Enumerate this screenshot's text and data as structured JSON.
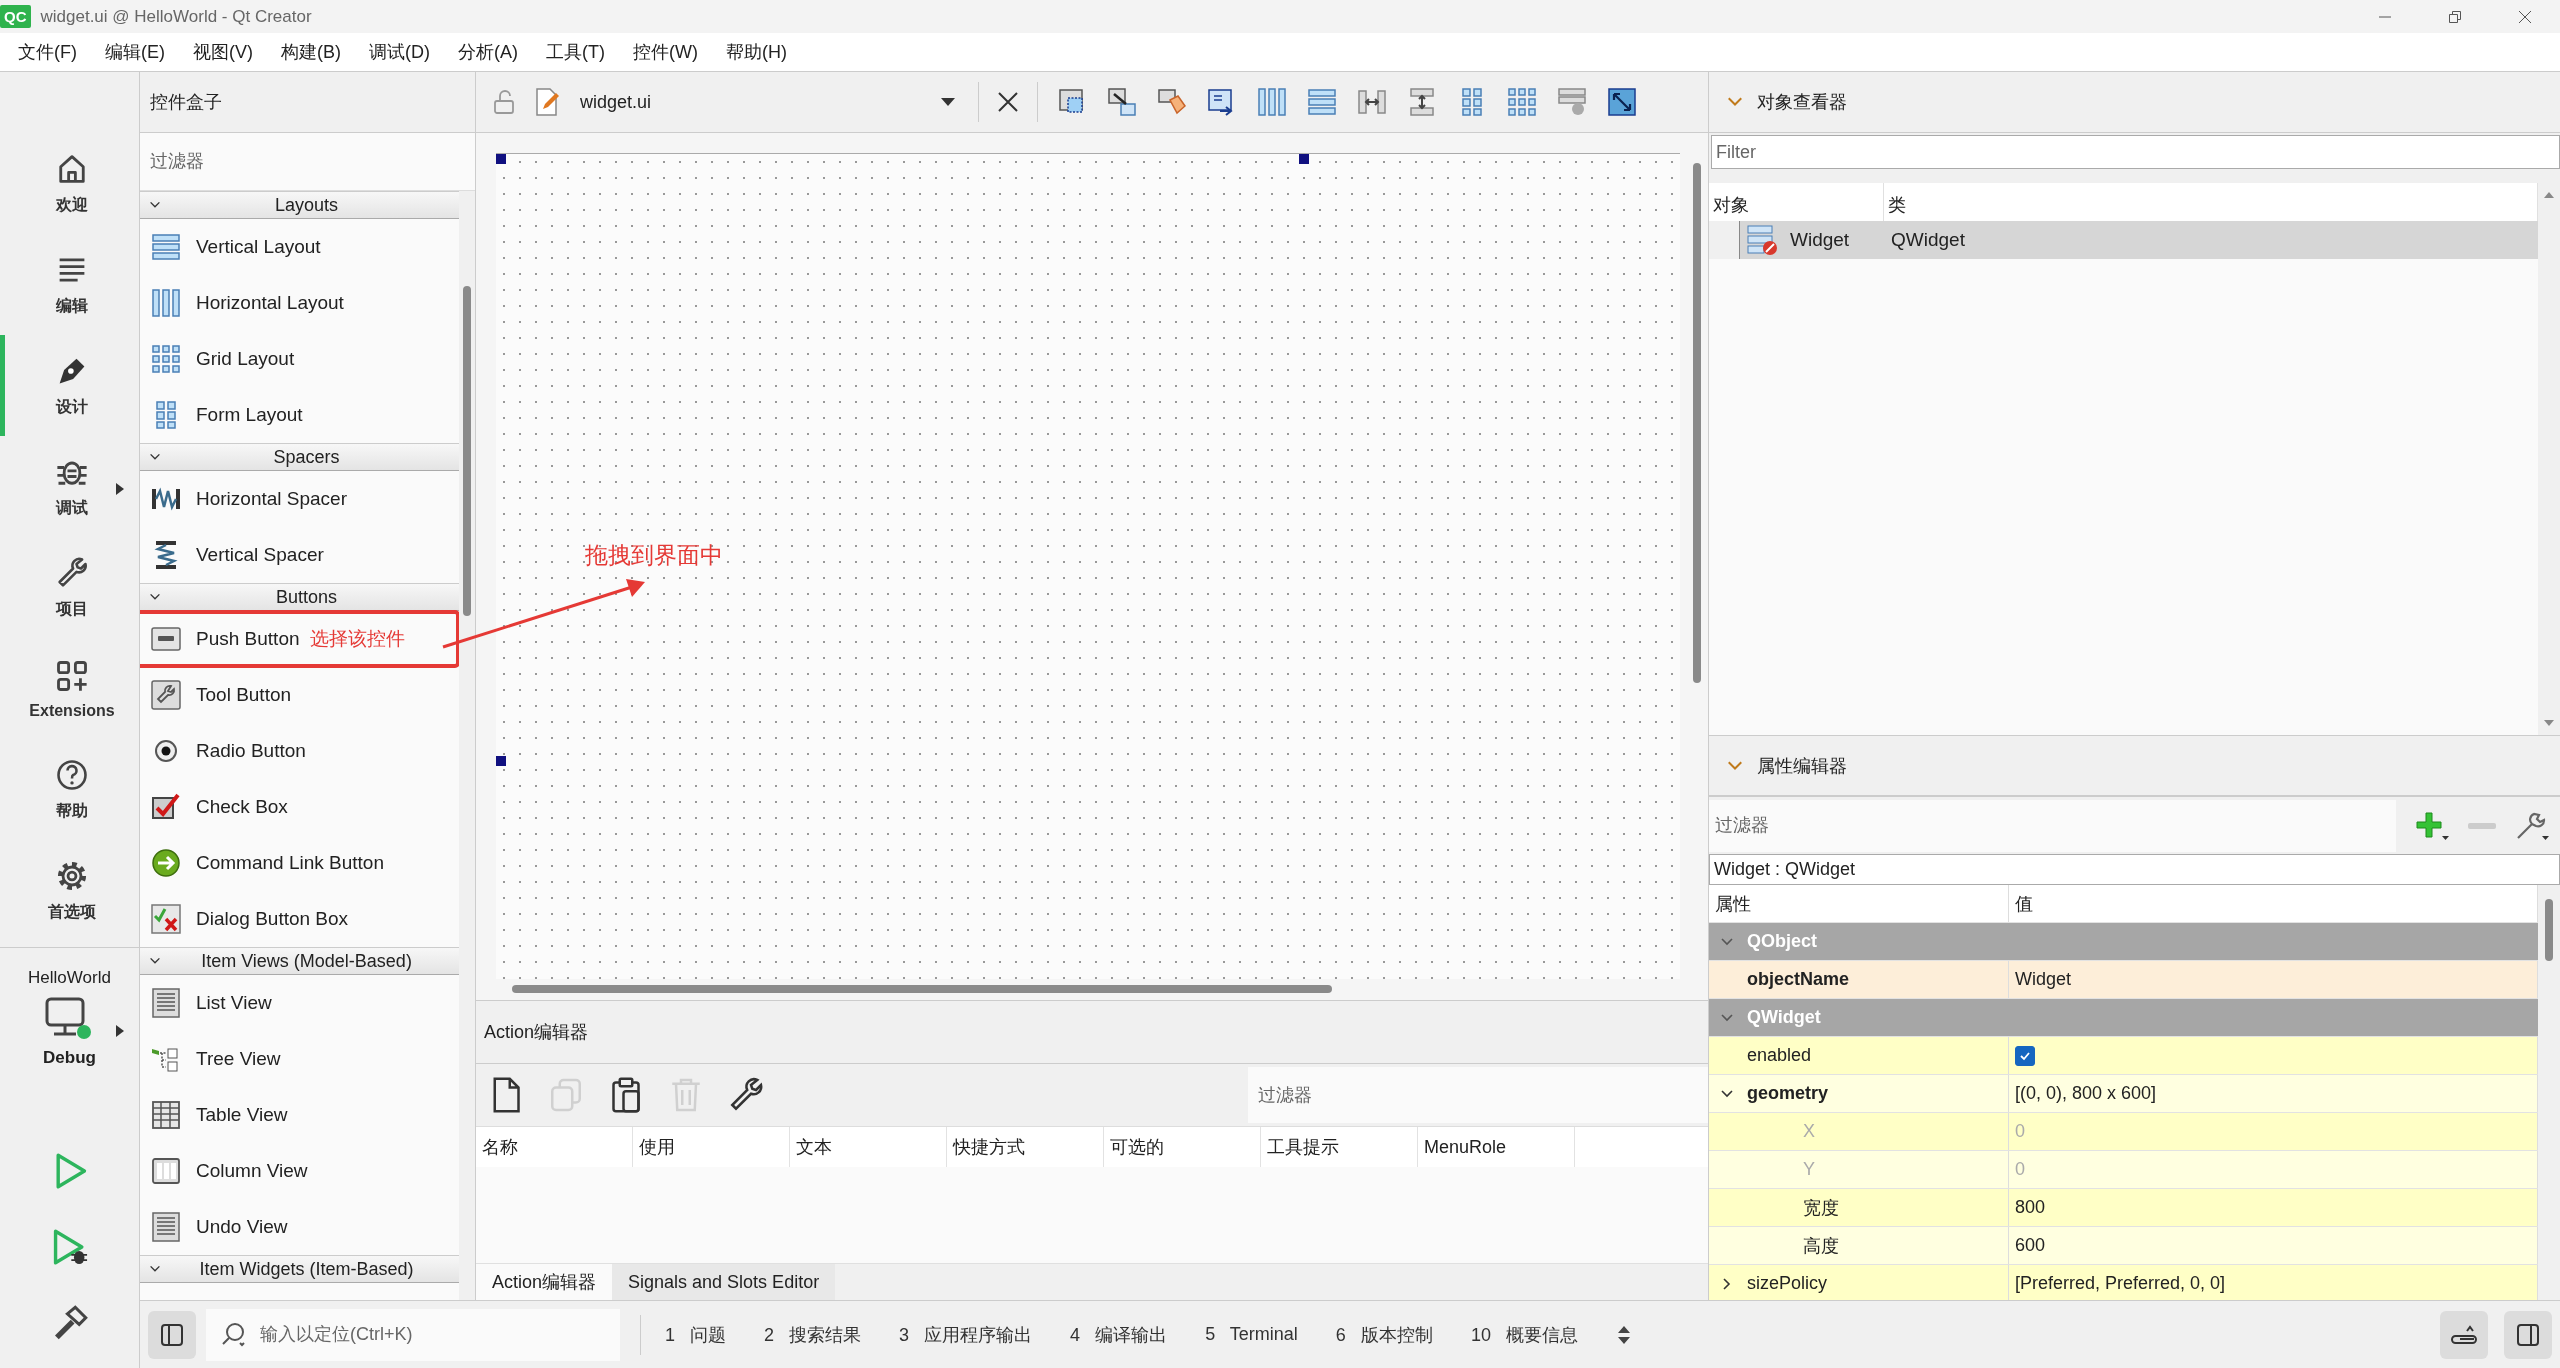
{
  "window": {
    "app_badge": "QC",
    "title": "widget.ui @ HelloWorld - Qt Creator"
  },
  "menu": [
    "文件(F)",
    "编辑(E)",
    "视图(V)",
    "构建(B)",
    "调试(D)",
    "分析(A)",
    "工具(T)",
    "控件(W)",
    "帮助(H)"
  ],
  "modes": [
    {
      "kind": "home",
      "label": "欢迎",
      "selected": false,
      "submenu": false
    },
    {
      "kind": "edit",
      "label": "编辑",
      "selected": false,
      "submenu": false
    },
    {
      "kind": "design",
      "label": "设计",
      "selected": true,
      "submenu": false
    },
    {
      "kind": "debug",
      "label": "调试",
      "selected": false,
      "submenu": true
    },
    {
      "kind": "project",
      "label": "项目",
      "selected": false,
      "submenu": false
    },
    {
      "kind": "extensions",
      "label": "Extensions",
      "selected": false,
      "submenu": false
    },
    {
      "kind": "help",
      "label": "帮助",
      "selected": false,
      "submenu": false
    },
    {
      "kind": "settings",
      "label": "首选项",
      "selected": false,
      "submenu": false
    }
  ],
  "target": {
    "project": "HelloWorld",
    "config": "Debug"
  },
  "actions": [
    {
      "kind": "run"
    },
    {
      "kind": "debug-run"
    },
    {
      "kind": "build"
    }
  ],
  "widget_box": {
    "title": "控件盒子",
    "filter_placeholder": "过滤器",
    "groups": [
      {
        "title": "Layouts",
        "expanded": true,
        "items": [
          {
            "kind": "vertical-layout",
            "label": "Vertical Layout",
            "highlighted": false
          },
          {
            "kind": "horizontal-layout",
            "label": "Horizontal Layout",
            "highlighted": false
          },
          {
            "kind": "grid-layout",
            "label": "Grid Layout",
            "highlighted": false
          },
          {
            "kind": "form-layout",
            "label": "Form Layout",
            "highlighted": false
          }
        ]
      },
      {
        "title": "Spacers",
        "expanded": true,
        "items": [
          {
            "kind": "horizontal-spacer",
            "label": "Horizontal Spacer",
            "highlighted": false
          },
          {
            "kind": "vertical-spacer",
            "label": "Vertical Spacer",
            "highlighted": false
          }
        ]
      },
      {
        "title": "Buttons",
        "expanded": true,
        "items": [
          {
            "kind": "push-button",
            "label": "Push Button",
            "highlighted": true,
            "note": "选择该控件"
          },
          {
            "kind": "tool-button",
            "label": "Tool Button",
            "highlighted": false
          },
          {
            "kind": "radio-button",
            "label": "Radio Button",
            "highlighted": false
          },
          {
            "kind": "check-box",
            "label": "Check Box",
            "highlighted": false
          },
          {
            "kind": "command-link-button",
            "label": "Command Link Button",
            "highlighted": false
          },
          {
            "kind": "dialog-button-box",
            "label": "Dialog Button Box",
            "highlighted": false
          }
        ]
      },
      {
        "title": "Item Views (Model-Based)",
        "expanded": true,
        "items": [
          {
            "kind": "list-view",
            "label": "List View",
            "highlighted": false
          },
          {
            "kind": "tree-view",
            "label": "Tree View",
            "highlighted": false
          },
          {
            "kind": "table-view",
            "label": "Table View",
            "highlighted": false
          },
          {
            "kind": "column-view",
            "label": "Column View",
            "highlighted": false
          },
          {
            "kind": "undo-view",
            "label": "Undo View",
            "highlighted": false
          }
        ]
      },
      {
        "title": "Item Widgets (Item-Based)",
        "expanded": true
      }
    ]
  },
  "form_editor": {
    "file": "widget.ui",
    "tools": [
      {
        "kind": "edit-widgets"
      },
      {
        "kind": "edit-signals"
      },
      {
        "kind": "edit-buddies"
      },
      {
        "kind": "edit-tab-order"
      },
      {
        "kind": "horizontal-layout"
      },
      {
        "kind": "vertical-layout"
      },
      {
        "kind": "split-horizontal"
      },
      {
        "kind": "split-vertical"
      },
      {
        "kind": "form-layout"
      },
      {
        "kind": "grid-layout"
      },
      {
        "kind": "break-layout"
      },
      {
        "kind": "adjust-size"
      }
    ],
    "drag_hint": "拖拽到界面中"
  },
  "action_editor": {
    "title": "Action编辑器",
    "tools": [
      {
        "kind": "new",
        "disabled": false
      },
      {
        "kind": "copy",
        "disabled": true
      },
      {
        "kind": "paste",
        "disabled": false
      },
      {
        "kind": "delete",
        "disabled": true
      },
      {
        "kind": "configure",
        "disabled": false
      }
    ],
    "filter_placeholder": "过滤器",
    "columns": [
      "名称",
      "使用",
      "文本",
      "快捷方式",
      "可选的",
      "工具提示",
      "MenuRole"
    ],
    "tabs": [
      {
        "label": "Action编辑器",
        "selected": true
      },
      {
        "label": "Signals and Slots Editor",
        "selected": false
      }
    ]
  },
  "object_inspector": {
    "title": "对象查看器",
    "filter_placeholder": "Filter",
    "columns": [
      "对象",
      "类"
    ],
    "rows": [
      {
        "object": "Widget",
        "class": "QWidget",
        "selected": true
      }
    ]
  },
  "property_editor": {
    "title": "属性编辑器",
    "filter_placeholder": "过滤器",
    "object_label": "Widget : QWidget",
    "columns": [
      "属性",
      "值"
    ],
    "groups": [
      {
        "name": "QObject",
        "expanded": true,
        "properties": [
          {
            "kind": "text",
            "name": "objectName",
            "value": "Widget",
            "modified": true
          }
        ]
      },
      {
        "name": "QWidget",
        "expanded": true,
        "properties": [
          {
            "kind": "checkbox",
            "name": "enabled",
            "checked": true,
            "modified": false
          },
          {
            "kind": "text",
            "name": "geometry",
            "value": "[(0, 0), 800 x 600]",
            "modified": true,
            "expanded": true,
            "children": [
              {
                "name": "X",
                "value": "0",
                "disabled": true
              },
              {
                "name": "Y",
                "value": "0",
                "disabled": true
              },
              {
                "name": "宽度",
                "value": "800",
                "disabled": false
              },
              {
                "name": "高度",
                "value": "600",
                "disabled": false
              }
            ]
          },
          {
            "kind": "text",
            "name": "sizePolicy",
            "value": "[Preferred, Preferred, 0, 0]",
            "modified": false,
            "expanded": false
          }
        ]
      }
    ]
  },
  "status_bar": {
    "locator_placeholder": "输入以定位(Ctrl+K)",
    "panes": [
      {
        "number": "1",
        "label": "问题"
      },
      {
        "number": "2",
        "label": "搜索结果"
      },
      {
        "number": "3",
        "label": "应用程序输出"
      },
      {
        "number": "4",
        "label": "编译输出"
      },
      {
        "number": "5",
        "label": "Terminal"
      },
      {
        "number": "6",
        "label": "版本控制"
      },
      {
        "number": "10",
        "label": "概要信息"
      }
    ]
  }
}
